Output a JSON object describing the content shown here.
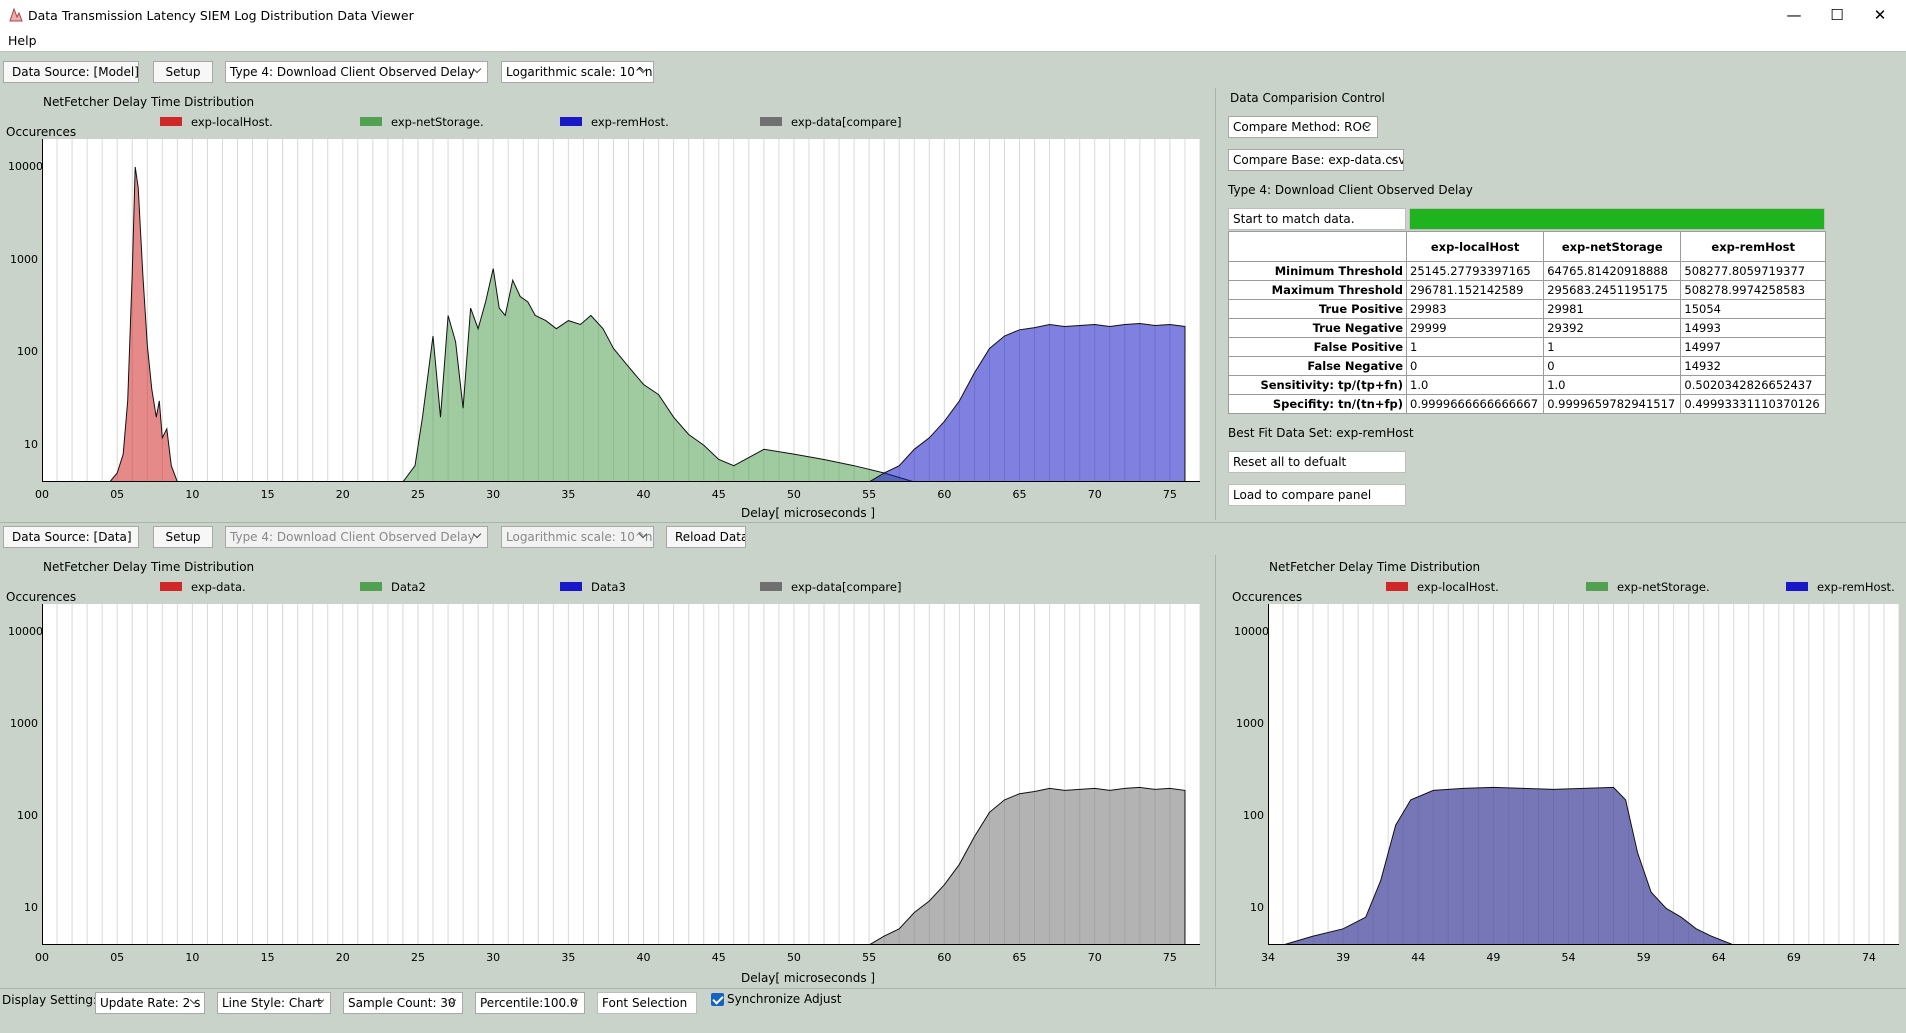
{
  "window": {
    "title": "Data Transmission Latency SIEM Log Distribution Data Viewer",
    "menu_help": "Help"
  },
  "top_toolbar": {
    "data_source_label": "Data Source: [Model]",
    "setup_label": "Setup",
    "type_value": "Type 4: Download Client Observed Delay",
    "scale_value": "Logarithmic scale: 10^n"
  },
  "mid_toolbar": {
    "data_source_label": "Data Source: [Data]",
    "setup_label": "Setup",
    "type_value": "Type 4: Download Client Observed Delay",
    "scale_value": "Logarithmic scale: 10^n",
    "reload_label": "Reload Data"
  },
  "chart_common": {
    "title": "NetFetcher Delay Time Distribution",
    "ylabel": "Occurences",
    "xlabel": "Delay[ microseconds ]",
    "y_ticks": [
      "10000",
      "1000",
      "100",
      "10"
    ]
  },
  "top_chart": {
    "legend": [
      {
        "label": "exp-localHost.",
        "color": "#d02828"
      },
      {
        "label": "exp-netStorage.",
        "color": "#52a052"
      },
      {
        "label": "exp-remHost.",
        "color": "#1818c8"
      },
      {
        "label": "exp-data[compare]",
        "color": "#707070"
      }
    ],
    "x_ticks": [
      "00",
      "05",
      "10",
      "15",
      "20",
      "25",
      "30",
      "35",
      "40",
      "45",
      "50",
      "55",
      "60",
      "65",
      "70",
      "75"
    ]
  },
  "bottom_left_chart": {
    "legend": [
      {
        "label": "exp-data.",
        "color": "#d02828"
      },
      {
        "label": "Data2",
        "color": "#52a052"
      },
      {
        "label": "Data3",
        "color": "#1818c8"
      },
      {
        "label": "exp-data[compare]",
        "color": "#707070"
      }
    ],
    "x_ticks": [
      "00",
      "05",
      "10",
      "15",
      "20",
      "25",
      "30",
      "35",
      "40",
      "45",
      "50",
      "55",
      "60",
      "65",
      "70",
      "75"
    ]
  },
  "bottom_right_chart": {
    "legend": [
      {
        "label": "exp-localHost.",
        "color": "#d02828"
      },
      {
        "label": "exp-netStorage.",
        "color": "#52a052"
      },
      {
        "label": "exp-remHost.",
        "color": "#1818c8"
      }
    ],
    "x_ticks": [
      "34",
      "39",
      "44",
      "49",
      "54",
      "59",
      "64",
      "69",
      "74"
    ]
  },
  "compare_panel": {
    "heading": "Data Comparision Control",
    "method_value": "Compare Method: ROC",
    "base_value": "Compare Base: exp-data.csv",
    "type_text": "Type 4: Download Client Observed Delay",
    "start_button": "Start to match data.",
    "progress": 1.0,
    "progress_color": "#1fb31f",
    "columns": [
      "exp-localHost",
      "exp-netStorage",
      "exp-remHost"
    ],
    "rows": [
      {
        "label": "Minimum Threshold",
        "values": [
          "25145.27793397165",
          "64765.81420918888",
          "508277.8059719377"
        ]
      },
      {
        "label": "Maximum Threshold",
        "values": [
          "296781.152142589",
          "295683.2451195175",
          "508278.9974258583"
        ]
      },
      {
        "label": "True Positive",
        "values": [
          "29983",
          "29981",
          "15054"
        ]
      },
      {
        "label": "True Negative",
        "values": [
          "29999",
          "29392",
          "14993"
        ]
      },
      {
        "label": "False Positive",
        "values": [
          "1",
          "1",
          "14997"
        ]
      },
      {
        "label": "False Negative",
        "values": [
          "0",
          "0",
          "14932"
        ]
      },
      {
        "label": "Sensitivity: tp/(tp+fn)",
        "values": [
          "1.0",
          "1.0",
          "0.5020342826652437"
        ]
      },
      {
        "label": "Specifity: tn/(tn+fp)",
        "values": [
          "0.9999666666666667",
          "0.9999659782941517",
          "0.49993331110370126"
        ]
      }
    ],
    "best_fit": "Best Fit Data Set: exp-remHost",
    "reset_button": "Reset all to defualt",
    "load_button": "Load to compare panel"
  },
  "bottom_bar": {
    "label": "Display Setting:",
    "update_rate": "Update Rate: 2 s",
    "line_style": "Line Style: Chart",
    "sample_count": "Sample Count: 30",
    "percentile": "Percentile:100.0",
    "font_selection": "Font Selection",
    "sync_label": "Synchronize Adjust",
    "sync_checked": true
  },
  "chart_data": [
    {
      "type": "area",
      "title": "NetFetcher Delay Time Distribution",
      "xlabel": "Delay[ microseconds ]",
      "ylabel": "Occurences",
      "y_scale": "log",
      "xlim": [
        0,
        77
      ],
      "ylim": [
        4,
        20000
      ],
      "grid": true,
      "legend_placement": "top",
      "series": [
        {
          "name": "exp-localHost.",
          "color": "#d02828",
          "x": [
            4.5,
            5.0,
            5.4,
            5.7,
            6.0,
            6.2,
            6.4,
            6.7,
            7.0,
            7.3,
            7.6,
            7.8,
            8.0,
            8.3,
            8.6,
            9.0
          ],
          "y": [
            4,
            5,
            8,
            30,
            700,
            10000,
            6000,
            700,
            120,
            40,
            20,
            30,
            12,
            15,
            6,
            4
          ]
        },
        {
          "name": "exp-netStorage.",
          "color": "#52a052",
          "x": [
            24,
            24.8,
            25.3,
            26.0,
            26.5,
            27.0,
            27.5,
            28.0,
            28.5,
            29.0,
            29.5,
            30.0,
            30.4,
            30.8,
            31.3,
            31.8,
            32.3,
            32.8,
            33.5,
            34.2,
            35.0,
            35.8,
            36.5,
            37.3,
            38.0,
            39.0,
            40.0,
            41.0,
            42.0,
            43.0,
            44.0,
            45.0,
            46.0,
            48.0,
            50.0,
            52.0,
            54.0,
            56.0,
            58.0
          ],
          "y": [
            4,
            6,
            20,
            150,
            20,
            250,
            130,
            25,
            300,
            180,
            350,
            800,
            300,
            250,
            600,
            400,
            350,
            250,
            220,
            180,
            220,
            200,
            250,
            180,
            110,
            70,
            45,
            35,
            20,
            13,
            10,
            7,
            6,
            9,
            8,
            7,
            6,
            5,
            4
          ]
        },
        {
          "name": "exp-remHost.",
          "color": "#1818c8",
          "x": [
            55.0,
            56.0,
            57.0,
            58.0,
            59.0,
            60.0,
            61.0,
            62.0,
            63.0,
            64.0,
            65.0,
            66.0,
            67.0,
            68.0,
            69.0,
            70.0,
            71.0,
            72.0,
            73.0,
            74.0,
            75.0,
            76.0
          ],
          "y": [
            4,
            5,
            6,
            9,
            12,
            18,
            30,
            60,
            110,
            150,
            175,
            185,
            200,
            190,
            195,
            200,
            190,
            200,
            205,
            195,
            200,
            190
          ]
        }
      ]
    },
    {
      "type": "area",
      "title": "NetFetcher Delay Time Distribution",
      "xlabel": "Delay[ microseconds ]",
      "ylabel": "Occurences",
      "y_scale": "log",
      "xlim": [
        0,
        77
      ],
      "ylim": [
        4,
        20000
      ],
      "grid": true,
      "legend_placement": "top",
      "series": [
        {
          "name": "exp-data[compare]",
          "color": "#808080",
          "x": [
            55.0,
            56.0,
            57.0,
            58.0,
            59.0,
            60.0,
            61.0,
            62.0,
            63.0,
            64.0,
            65.0,
            66.0,
            67.0,
            68.0,
            69.0,
            70.0,
            71.0,
            72.0,
            73.0,
            74.0,
            75.0,
            76.0
          ],
          "y": [
            4,
            5,
            6,
            9,
            12,
            18,
            30,
            60,
            110,
            150,
            175,
            185,
            200,
            190,
            195,
            200,
            190,
            200,
            205,
            195,
            200,
            190
          ]
        }
      ]
    },
    {
      "type": "area",
      "title": "NetFetcher Delay Time Distribution",
      "ylabel": "Occurences",
      "y_scale": "log",
      "xlim": [
        34,
        76
      ],
      "ylim": [
        4,
        20000
      ],
      "grid": true,
      "legend_placement": "top",
      "series": [
        {
          "name": "exp-remHost.",
          "color": "#4a4aa0",
          "x": [
            35.0,
            37.0,
            39.0,
            40.5,
            41.5,
            42.5,
            43.5,
            45.0,
            47.0,
            49.0,
            51.0,
            53.0,
            55.0,
            57.0,
            57.8,
            58.6,
            59.5,
            60.5,
            61.5,
            62.5,
            63.5,
            65.0
          ],
          "y": [
            4,
            5,
            6,
            8,
            20,
            80,
            150,
            190,
            200,
            205,
            200,
            195,
            200,
            205,
            150,
            40,
            15,
            10,
            8,
            6,
            5,
            4
          ]
        }
      ]
    }
  ]
}
